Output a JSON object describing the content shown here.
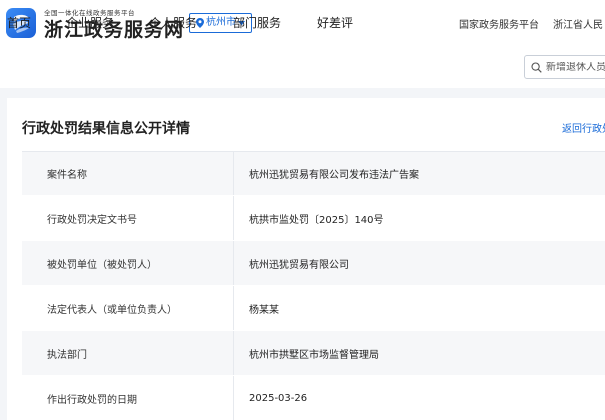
{
  "header": {
    "logo_subtitle": "全国一体化在线政务服务平台",
    "logo_title": "浙江政务服务网",
    "city": "杭州市",
    "top_links": [
      "国家政务服务平台",
      "浙江省人民"
    ]
  },
  "nav": {
    "items": [
      "首页",
      "企业服务",
      "个人服务",
      "部门服务",
      "好差评"
    ],
    "search_placeholder": "新增退休人员"
  },
  "detail": {
    "title": "行政处罚结果信息公开详情",
    "back_link": "返回行政处",
    "rows": [
      {
        "label": "案件名称",
        "value": "杭州迅犹贸易有限公司发布违法广告案"
      },
      {
        "label": "行政处罚决定文书号",
        "value": "杭拱市监处罚〔2025〕140号"
      },
      {
        "label": "被处罚单位（被处罚人）",
        "value": "杭州迅犹贸易有限公司"
      },
      {
        "label": "法定代表人（或单位负责人）",
        "value": "杨某某"
      },
      {
        "label": "执法部门",
        "value": "杭州市拱墅区市场监督管理局"
      },
      {
        "label": "作出行政处罚的日期",
        "value": "2025-03-26"
      }
    ]
  },
  "colors": {
    "brand_blue": "#1a6bd8",
    "page_bg": "#f3f5f8",
    "row_stripe": "#f6f7f9"
  },
  "icons": [
    "app-logo-icon",
    "location-pin-icon",
    "caret-down-icon",
    "search-icon"
  ]
}
